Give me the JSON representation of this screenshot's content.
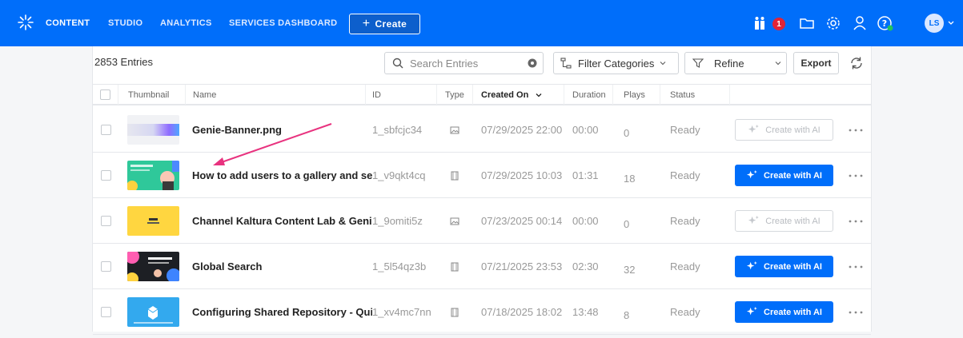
{
  "topbar": {
    "nav": [
      "CONTENT",
      "STUDIO",
      "ANALYTICS",
      "SERVICES DASHBOARD"
    ],
    "create_label": "Create",
    "notifications_count": "1",
    "avatar_initials": "LS"
  },
  "toolbar": {
    "entries_count": "2853 Entries",
    "search_placeholder": "Search Entries",
    "filter_categories": "Filter Categories",
    "refine": "Refine",
    "export": "Export"
  },
  "table": {
    "columns": [
      "Thumbnail",
      "Name",
      "ID",
      "Type",
      "Created On",
      "Duration",
      "Plays",
      "Status"
    ],
    "rows": [
      {
        "name": "Genie-Banner.png",
        "id": "1_sbfcjc34",
        "type": "image-icon",
        "created": "07/29/2025 22:00",
        "duration": "00:00",
        "plays": "0",
        "status": "Ready",
        "ai_label": "Create with AI",
        "ai_enabled": false,
        "thumb": "banner"
      },
      {
        "name": "How to add users to a gallery and set ...",
        "id": "1_v9qkt4cq",
        "type": "video-icon",
        "created": "07/29/2025 10:03",
        "duration": "01:31",
        "plays": "18",
        "status": "Ready",
        "ai_label": "Create with AI",
        "ai_enabled": true,
        "thumb": "green"
      },
      {
        "name": "Channel Kaltura Content Lab & Genie...",
        "id": "1_9omiti5z",
        "type": "image-icon",
        "created": "07/23/2025 00:14",
        "duration": "00:00",
        "plays": "0",
        "status": "Ready",
        "ai_label": "Create with AI",
        "ai_enabled": false,
        "thumb": "yellow"
      },
      {
        "name": "Global Search",
        "id": "1_5l54qz3b",
        "type": "video-icon",
        "created": "07/21/2025 23:53",
        "duration": "02:30",
        "plays": "32",
        "status": "Ready",
        "ai_label": "Create with AI",
        "ai_enabled": true,
        "thumb": "dark"
      },
      {
        "name": "Configuring Shared Repository - Quiz",
        "id": "1_xv4mc7nn",
        "type": "video-icon",
        "created": "07/18/2025 18:02",
        "duration": "13:48",
        "plays": "8",
        "status": "Ready",
        "ai_label": "Create with AI",
        "ai_enabled": true,
        "thumb": "blue"
      }
    ]
  },
  "colors": {
    "brand": "#006efa",
    "annotation_arrow": "#e8337f"
  }
}
